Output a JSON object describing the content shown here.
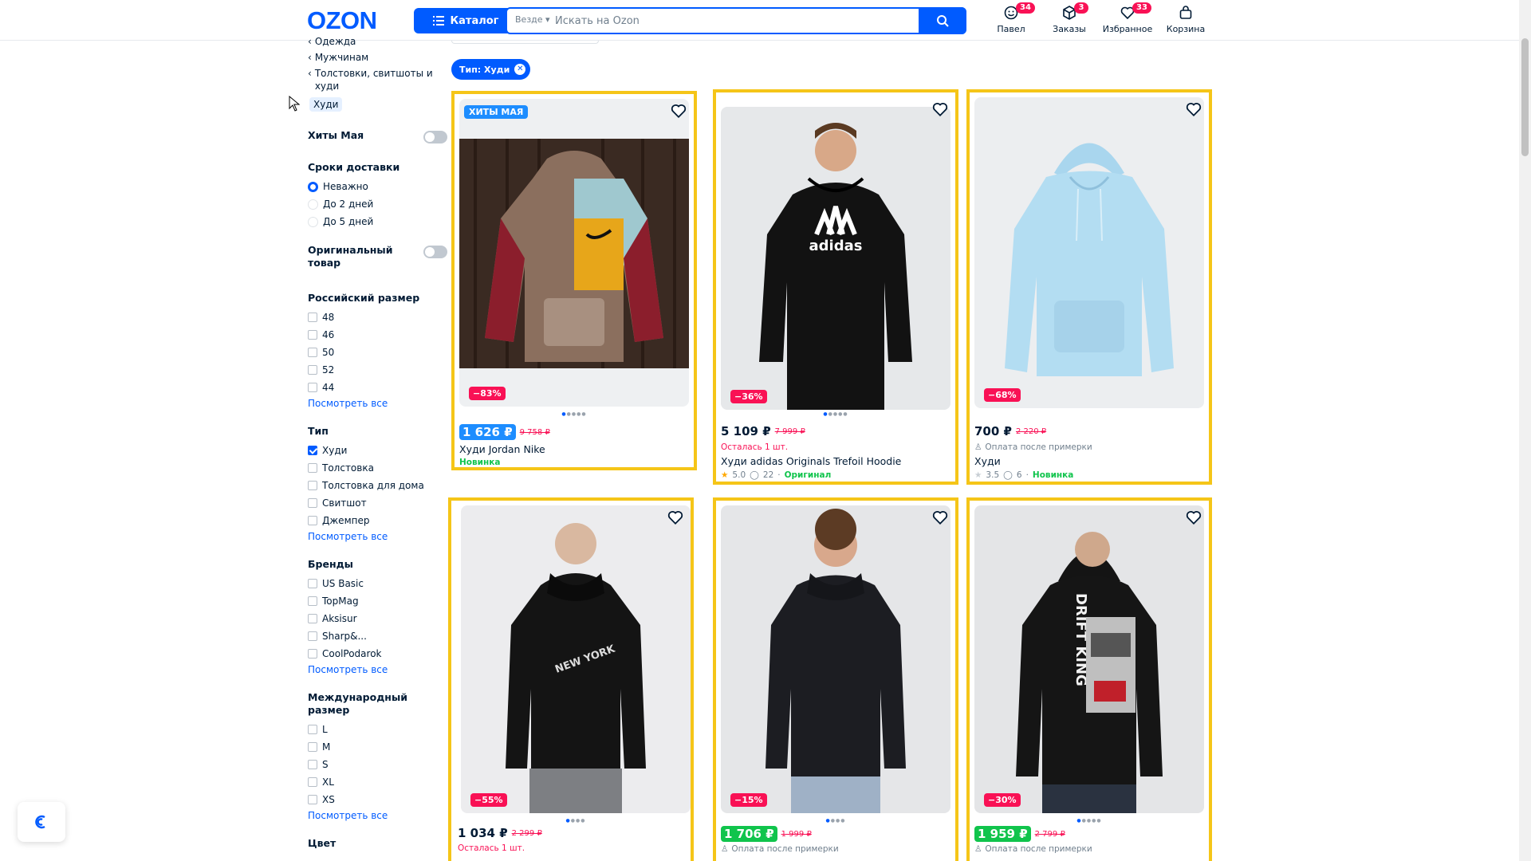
{
  "header": {
    "logo": "OZON",
    "catalog_label": "Каталог",
    "search_scope": "Везде",
    "search_placeholder": "Искать на Ozon",
    "items": [
      {
        "label": "Павел",
        "badge": "34",
        "icon": "profile-face-icon"
      },
      {
        "label": "Заказы",
        "badge": "3",
        "icon": "box-icon"
      },
      {
        "label": "Избранное",
        "badge": "33",
        "icon": "heart-icon"
      },
      {
        "label": "Корзина",
        "badge": "",
        "icon": "cart-bag-icon"
      }
    ]
  },
  "sidebar": {
    "breadcrumbs": [
      "Одежда",
      "Мужчинам",
      "Толстовки, свитшоты и худи"
    ],
    "current_category": "Худи",
    "hits_toggle": "Хиты Мая",
    "delivery": {
      "title": "Сроки доставки",
      "options": [
        "Неважно",
        "До 2 дней",
        "До 5 дней"
      ],
      "selected": "Неважно"
    },
    "original_toggle": "Оригинальный товар",
    "ru_size": {
      "title": "Российский размер",
      "options": [
        "48",
        "46",
        "50",
        "52",
        "44"
      ],
      "see_all": "Посмотреть все"
    },
    "type": {
      "title": "Тип",
      "options": [
        "Худи",
        "Толстовка",
        "Толстовка для дома",
        "Свитшот",
        "Джемпер"
      ],
      "checked": "Худи",
      "see_all": "Посмотреть все"
    },
    "brands": {
      "title": "Бренды",
      "options": [
        "US Basic",
        "TopMag",
        "Aksisur",
        "Sharp&...",
        "CoolPodarok"
      ],
      "see_all": "Посмотреть все"
    },
    "intl_size": {
      "title": "Международный размер",
      "options": [
        "L",
        "M",
        "S",
        "XL",
        "XS"
      ],
      "see_all": "Посмотреть все"
    },
    "color_title": "Цвет"
  },
  "active_filter": "Тип: Худи",
  "products": [
    {
      "badge": "ХИТЫ МАЯ",
      "discount": "−83%",
      "price": "1 626 ₽",
      "old_price": "9 758 ₽",
      "price_style": "highlight",
      "name": "Худи Jordan Nike",
      "tag": "Новинка"
    },
    {
      "discount": "−36%",
      "price": "5 109 ₽",
      "old_price": "7 999 ₽",
      "price_style": "plain",
      "stock": "Осталась 1 шт.",
      "name": "Худи adidas Originals Trefoil Hoodie",
      "rating": "5.0",
      "reviews": "22",
      "tag": "Оригинал"
    },
    {
      "discount": "−68%",
      "price": "700 ₽",
      "old_price": "2 220 ₽",
      "price_style": "plain",
      "payment": "Оплата после примерки",
      "name": "Худи",
      "rating": "3.5",
      "reviews": "6",
      "tag": "Новинка"
    },
    {
      "discount": "−55%",
      "price": "1 034 ₽",
      "old_price": "2 299 ₽",
      "price_style": "plain",
      "stock": "Осталась 1 шт."
    },
    {
      "discount": "−15%",
      "price": "1 706 ₽",
      "old_price": "1 999 ₽",
      "price_style": "green",
      "payment": "Оплата после примерки"
    },
    {
      "discount": "−30%",
      "price": "1 959 ₽",
      "old_price": "2 799 ₽",
      "price_style": "green",
      "payment": "Оплата после примерки"
    }
  ],
  "colors": {
    "brand": "#005bff",
    "sale": "#f91155",
    "highlight": "#f5c518",
    "green": "#10c44c"
  }
}
